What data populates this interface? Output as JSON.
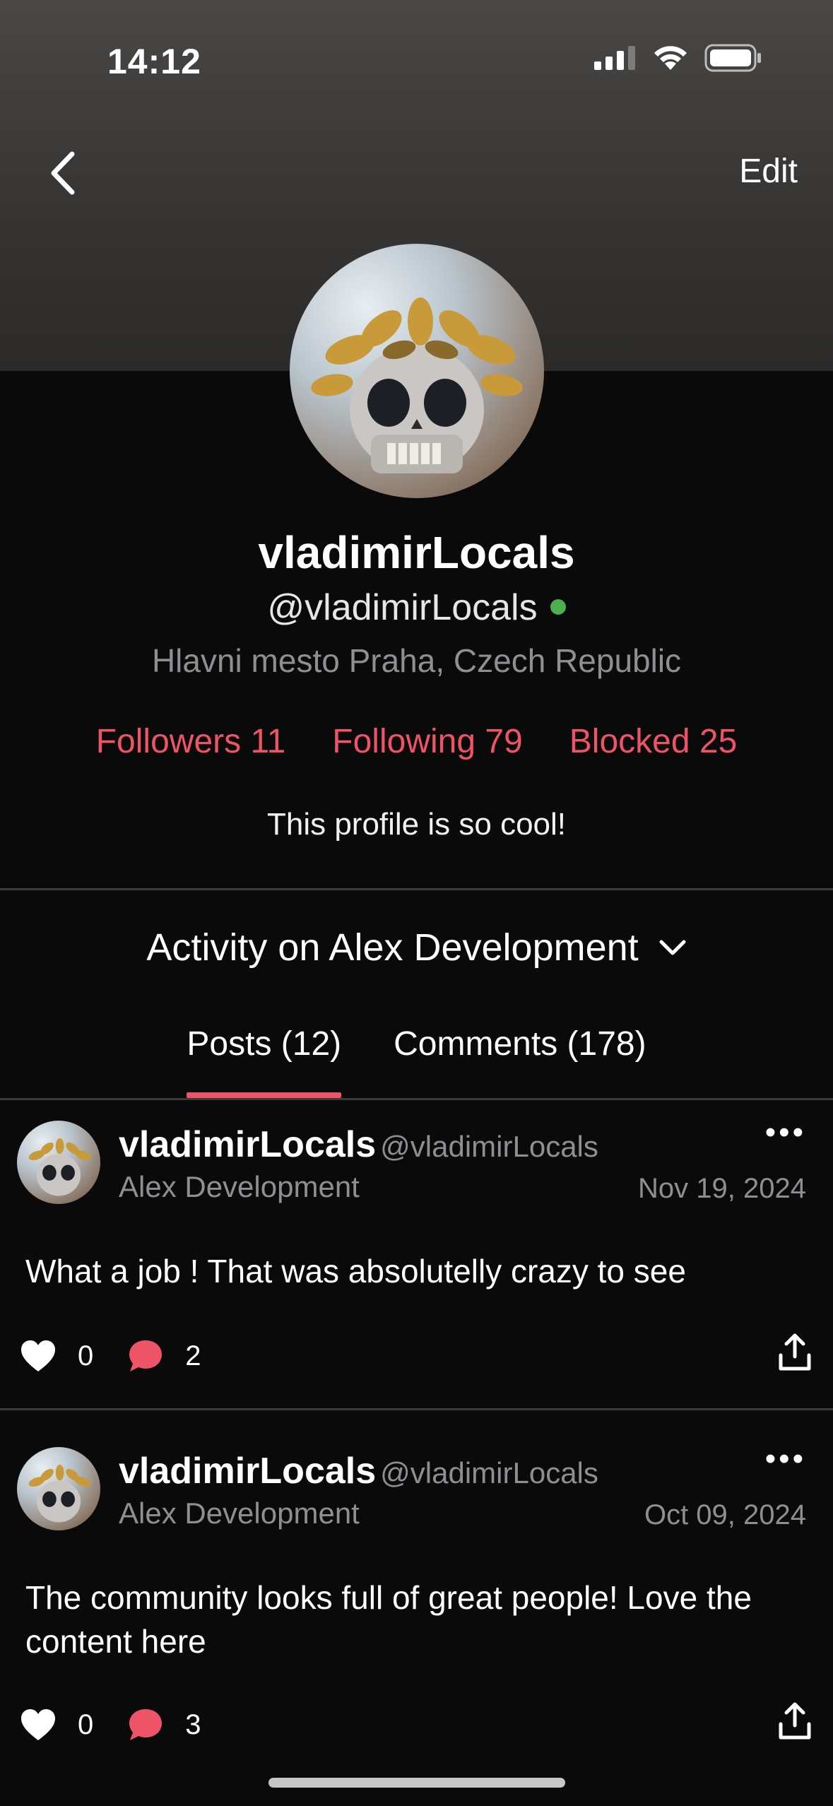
{
  "status_bar": {
    "time": "14:12"
  },
  "nav": {
    "edit_label": "Edit"
  },
  "profile": {
    "name": "vladimirLocals",
    "handle": "@vladimirLocals",
    "location": "Hlavni mesto Praha, Czech Republic",
    "followers": "Followers 11",
    "following": "Following 79",
    "blocked": "Blocked 25",
    "bio": "This profile is so cool!"
  },
  "activity": {
    "label": "Activity on Alex Development"
  },
  "tabs": [
    {
      "label": "Posts (12)",
      "active": true
    },
    {
      "label": "Comments (178)",
      "active": false
    }
  ],
  "posts": [
    {
      "name": "vladimirLocals",
      "handle": "@vladimirLocals",
      "community": "Alex Development",
      "date": "Nov 19, 2024",
      "body": "What a job ! That was absolutelly crazy to see",
      "likes": "0",
      "comments": "2"
    },
    {
      "name": "vladimirLocals",
      "handle": "@vladimirLocals",
      "community": "Alex Development",
      "date": "Oct 09, 2024",
      "body": "The community looks full of great people! Love the content here",
      "likes": "0",
      "comments": "3"
    }
  ],
  "colors": {
    "accent": "#ee5467",
    "online": "#4caf50",
    "muted": "#8e8e93"
  }
}
